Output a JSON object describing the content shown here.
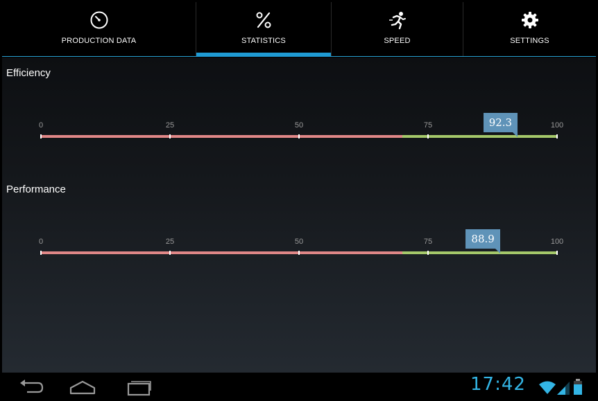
{
  "tabs": [
    {
      "label": "PRODUCTION DATA",
      "icon": "gauge-icon",
      "active": false
    },
    {
      "label": "STATISTICS",
      "icon": "percent-icon",
      "active": true
    },
    {
      "label": "SPEED",
      "icon": "runner-icon",
      "active": false
    },
    {
      "label": "SETTINGS",
      "icon": "gear-icon",
      "active": false
    }
  ],
  "scale": {
    "ticks": [
      "0",
      "25",
      "50",
      "75",
      "100"
    ],
    "min": 0,
    "max": 100,
    "good_threshold": 70
  },
  "gauges": [
    {
      "title": "Efficiency",
      "value": 92.3,
      "value_label": "92.3"
    },
    {
      "title": "Performance",
      "value": 88.9,
      "value_label": "88.9"
    }
  ],
  "colors": {
    "accent": "#1f9bd4",
    "bad": "#e08787",
    "good": "#a5c86a",
    "bubble": "#5f93b8",
    "clock": "#33b5e5"
  },
  "system_bar": {
    "time": "17:42",
    "icons": [
      "back-icon",
      "home-icon",
      "recent-apps-icon",
      "wifi-icon",
      "signal-icon",
      "battery-icon"
    ]
  }
}
